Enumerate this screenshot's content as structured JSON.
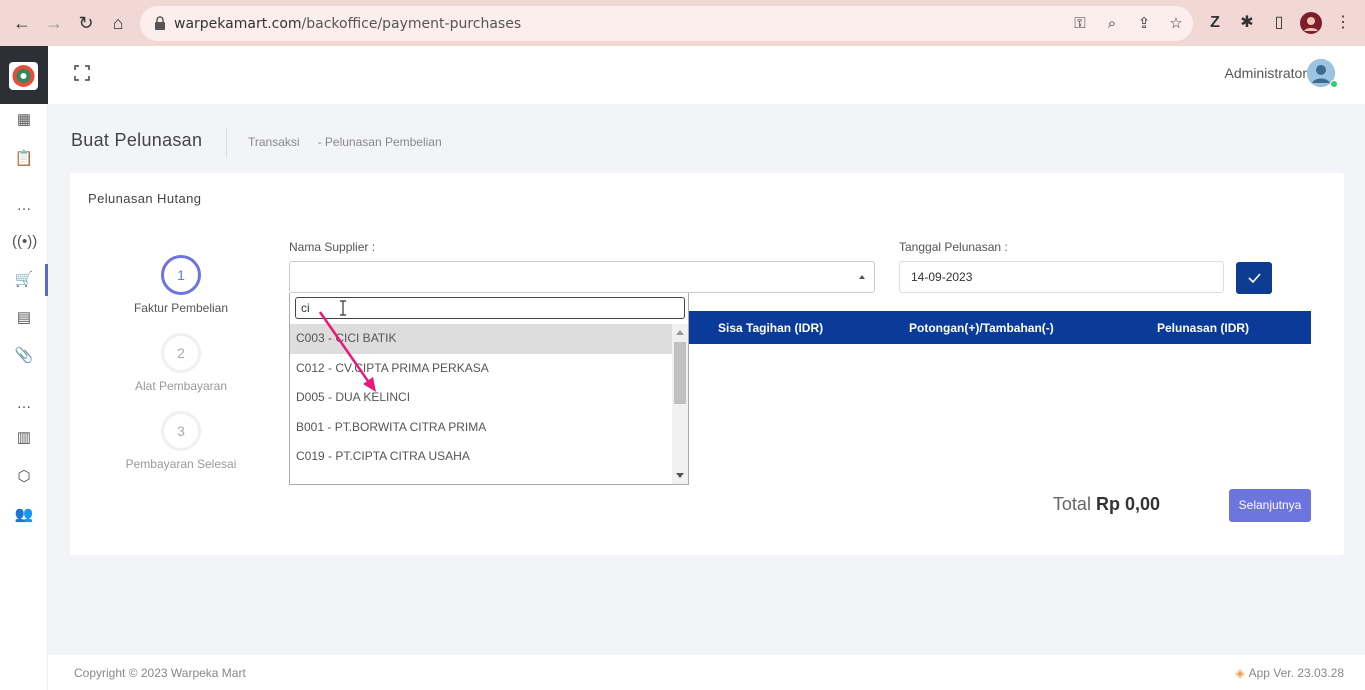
{
  "browser": {
    "url_domain": "warpekamart.com",
    "url_path": "/backoffice/payment-purchases"
  },
  "header": {
    "admin_name": "Administrator"
  },
  "page": {
    "title": "Buat Pelunasan",
    "breadcrumb": [
      "Transaksi",
      "- Pelunasan Pembelian"
    ]
  },
  "card": {
    "title": "Pelunasan Hutang",
    "steps": [
      {
        "number": "1",
        "label": "Faktur Pembelian"
      },
      {
        "number": "2",
        "label": "Alat Pembayaran"
      },
      {
        "number": "3",
        "label": "Pembayaran Selesai"
      }
    ],
    "supplier_label": "Nama Supplier :",
    "date_label": "Tanggal Pelunasan :",
    "date_value": "14-09-2023",
    "table_headers": [
      "Sisa Tagihan (IDR)",
      "Potongan(+)/Tambahan(-)",
      "Pelunasan (IDR)"
    ],
    "total_label": "Total",
    "total_value": "Rp 0,00",
    "next_button": "Selanjutnya"
  },
  "dropdown": {
    "search_value": "ci",
    "options": [
      "C003 - CICI BATIK",
      "C012 - CV.CIPTA PRIMA PERKASA",
      "D005 - DUA KELINCI",
      "B001 - PT.BORWITA CITRA PRIMA",
      "C019 - PT.CIPTA CITRA USAHA"
    ],
    "highlighted_index": 0
  },
  "footer": {
    "copyright": "Copyright © 2023 Warpeka Mart",
    "version": "App Ver. 23.03.28"
  },
  "colors": {
    "primary": "#6c74dd",
    "table_header": "#0a3a9a",
    "check_button": "#0d3d91",
    "annotation_arrow": "#e8197a"
  }
}
